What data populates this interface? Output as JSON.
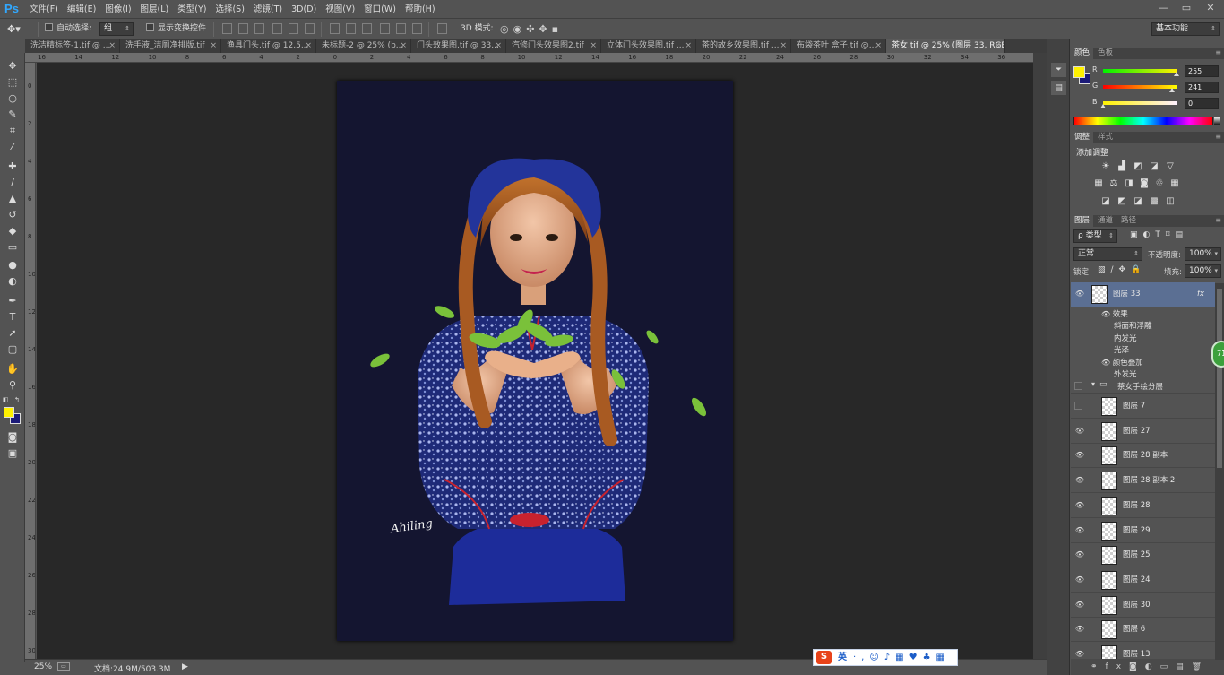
{
  "app": {
    "logo": "Ps"
  },
  "menu": [
    "文件(F)",
    "编辑(E)",
    "图像(I)",
    "图层(L)",
    "类型(Y)",
    "选择(S)",
    "滤镜(T)",
    "3D(D)",
    "视图(V)",
    "窗口(W)",
    "帮助(H)"
  ],
  "window_controls": {
    "minimize": "—",
    "restore": "▭",
    "close": "✕"
  },
  "options": {
    "auto_select_label": "自动选择:",
    "auto_select_value": "组",
    "show_transform_label": "显示变换控件",
    "mode_3d_label": "3D 模式:",
    "workspace": "基本功能"
  },
  "tabs": [
    {
      "label": "洗洁精标签-1.tif @ ...",
      "close": "×"
    },
    {
      "label": "洗手液_洁厕净排版.tif",
      "close": "×"
    },
    {
      "label": "渔具门头.tif @ 12.5...",
      "close": "×"
    },
    {
      "label": "未标题-2 @ 25% (b...",
      "close": "×"
    },
    {
      "label": "门头效果图.tif @ 33...",
      "close": "×"
    },
    {
      "label": "汽修门头效果图2.tif",
      "close": "×"
    },
    {
      "label": "立体门头效果图.tif ...",
      "close": "×"
    },
    {
      "label": "茶的故乡效果图.tif ...",
      "close": "×"
    },
    {
      "label": "布袋茶叶 盒子.tif @...",
      "close": "×"
    },
    {
      "label": "茶女.tif @ 25% (图层 33, RGB/8)",
      "close": "×"
    }
  ],
  "ruler": {
    "h": [
      "16",
      "14",
      "12",
      "10",
      "8",
      "6",
      "4",
      "2",
      "0",
      "2",
      "4",
      "6",
      "8",
      "10",
      "12",
      "14",
      "16",
      "18",
      "20",
      "22",
      "24",
      "26",
      "28",
      "30",
      "32",
      "34",
      "36"
    ],
    "v": [
      "0",
      "2",
      "4",
      "6",
      "8",
      "10",
      "12",
      "14",
      "16",
      "18",
      "20",
      "22",
      "24",
      "26",
      "28",
      "30"
    ]
  },
  "document": {
    "signature": "Ahiling"
  },
  "status": {
    "zoom": "25%",
    "doc_size": "文档:24.9M/503.3M",
    "arrow": "▶"
  },
  "color_panel": {
    "tabs": [
      "颜色",
      "色板"
    ],
    "channels": [
      {
        "label": "R",
        "value": "255",
        "level": 1.0
      },
      {
        "label": "G",
        "value": "241",
        "level": 0.945
      },
      {
        "label": "B",
        "value": "0",
        "level": 0.0
      }
    ],
    "foreground": "#fff100",
    "background": "#1b1a78"
  },
  "adjust_panel": {
    "tabs": [
      "调整",
      "样式"
    ],
    "title": "添加调整"
  },
  "layers_panel": {
    "tabs": [
      "图层",
      "通道",
      "路径"
    ],
    "filter_label": "ρ 类型",
    "blend_mode": "正常",
    "opacity_label": "不透明度:",
    "opacity": "100%",
    "lock_label": "锁定:",
    "fill_label": "填充:",
    "fill": "100%",
    "active_layer": {
      "name": "图层 33",
      "fx": "fx"
    },
    "effects_label": "效果",
    "effects": [
      "斜面和浮雕",
      "内发光",
      "光泽",
      "颜色叠加",
      "外发光"
    ],
    "group": "茶女手绘分层",
    "layers": [
      "图层 7",
      "图层 27",
      "图层 28 副本",
      "图层 28 副本 2",
      "图层 28",
      "图层 29",
      "图层 25",
      "图层 24",
      "图层 30",
      "图层 6",
      "图层 13"
    ]
  },
  "ime": {
    "logo": "S",
    "lang": "英"
  },
  "badge": "71"
}
